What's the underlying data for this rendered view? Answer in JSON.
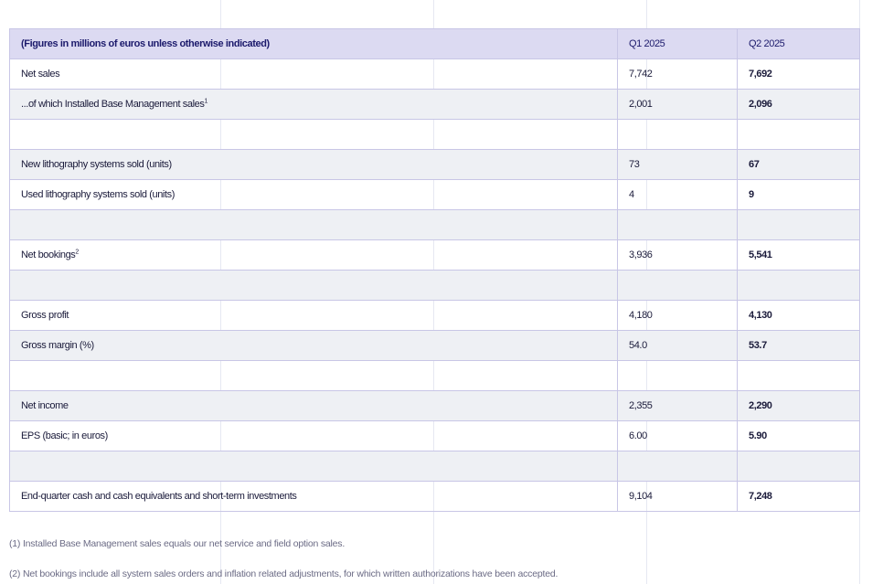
{
  "table": {
    "header": {
      "label": "(Figures in millions of euros unless otherwise indicated)",
      "col1": "Q1 2025",
      "col2": "Q2 2025"
    },
    "rows": [
      {
        "label": "Net sales",
        "sup": "",
        "q1": "7,742",
        "q2": "7,692"
      },
      {
        "label": "...of which Installed Base Management sales",
        "sup": "1",
        "q1": "2,001",
        "q2": "2,096"
      },
      {
        "label": "",
        "sup": "",
        "q1": "",
        "q2": ""
      },
      {
        "label": "New lithography systems sold (units)",
        "sup": "",
        "q1": "73",
        "q2": "67"
      },
      {
        "label": "Used lithography systems sold (units)",
        "sup": "",
        "q1": "4",
        "q2": "9"
      },
      {
        "label": "",
        "sup": "",
        "q1": "",
        "q2": ""
      },
      {
        "label": "Net bookings",
        "sup": "2",
        "q1": "3,936",
        "q2": "5,541"
      },
      {
        "label": "",
        "sup": "",
        "q1": "",
        "q2": ""
      },
      {
        "label": "Gross profit",
        "sup": "",
        "q1": "4,180",
        "q2": "4,130"
      },
      {
        "label": "Gross margin (%)",
        "sup": "",
        "q1": "54.0",
        "q2": "53.7"
      },
      {
        "label": "",
        "sup": "",
        "q1": "",
        "q2": ""
      },
      {
        "label": "Net income",
        "sup": "",
        "q1": "2,355",
        "q2": "2,290"
      },
      {
        "label": "EPS (basic; in euros)",
        "sup": "",
        "q1": "6.00",
        "q2": "5.90"
      },
      {
        "label": "",
        "sup": "",
        "q1": "",
        "q2": ""
      },
      {
        "label": "End-quarter cash and cash equivalents and short-term investments",
        "sup": "",
        "q1": "9,104",
        "q2": "7,248"
      }
    ]
  },
  "footnotes": [
    "(1) Installed Base Management sales equals our net service and field option sales.",
    "(2) Net bookings include all system sales orders and inflation related adjustments, for which written authorizations have been accepted."
  ],
  "colors": {
    "header_bg": "#dcdaf2",
    "border": "#c8c6e6",
    "alt_row_bg": "#eef0f4",
    "header_text": "#1c1a6c"
  }
}
